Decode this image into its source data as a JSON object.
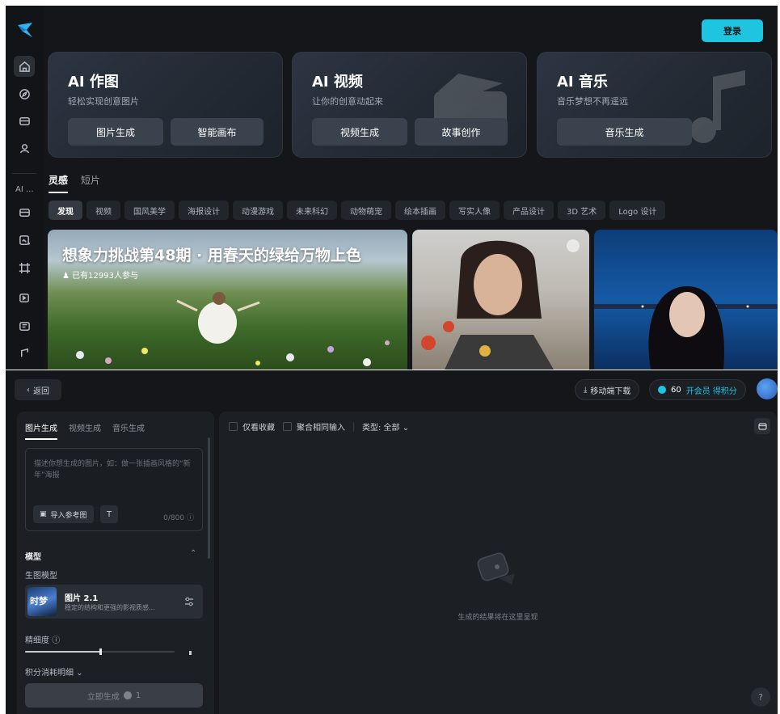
{
  "top": {
    "login_label": "登录",
    "rail_ai_label": "AI ...",
    "hero_cards": [
      {
        "title": "AI 作图",
        "subtitle": "轻松实现创意图片",
        "buttons": [
          "图片生成",
          "智能画布"
        ]
      },
      {
        "title": "AI 视频",
        "subtitle": "让你的创意动起来",
        "buttons": [
          "视频生成",
          "故事创作"
        ]
      },
      {
        "title": "AI 音乐",
        "subtitle": "音乐梦想不再遥远",
        "buttons": [
          "音乐生成"
        ]
      }
    ],
    "tabs": [
      "灵感",
      "短片"
    ],
    "chips": [
      "发现",
      "视频",
      "国风美学",
      "海报设计",
      "动漫游戏",
      "未来科幻",
      "动物萌宠",
      "绘本插画",
      "写实人像",
      "产品设计",
      "3D 艺术",
      "Logo 设计"
    ],
    "featured": {
      "title": "想象力挑战第48期 · 用春天的绿给万物上色",
      "participants": "已有12993人参与"
    }
  },
  "bottom": {
    "back_label": "返回",
    "mobile_download": "移动端下载",
    "credits": "60",
    "vip_label": "开会员 得积分",
    "left_tabs": [
      "图片生成",
      "视频生成",
      "音乐生成"
    ],
    "prompt_placeholder": "描述你想生成的图片，如：做一张插画风格的“新年”海报",
    "import_label": "导入参考图",
    "t_label": "T",
    "counter": "0/800",
    "model_section": "模型",
    "model_sub": "生图模型",
    "model_name": "图片 2.1",
    "model_desc": "稳定的结构和更强的影视质感...",
    "model_thumb_text": "时梦",
    "precision_label": "精细度",
    "precision_value": 0.5,
    "cost_detail": "积分消耗明细",
    "generate_label": "立即生成",
    "generate_cost": "1",
    "filter_favorites": "仅看收藏",
    "filter_merge": "聚合相同输入",
    "filter_type": "类型: 全部",
    "empty_text": "生成的结果将在这里呈现",
    "help_label": "?"
  },
  "colors": {
    "accent": "#1fc4e0",
    "bg": "#14161a",
    "panel": "#1c1f24"
  }
}
